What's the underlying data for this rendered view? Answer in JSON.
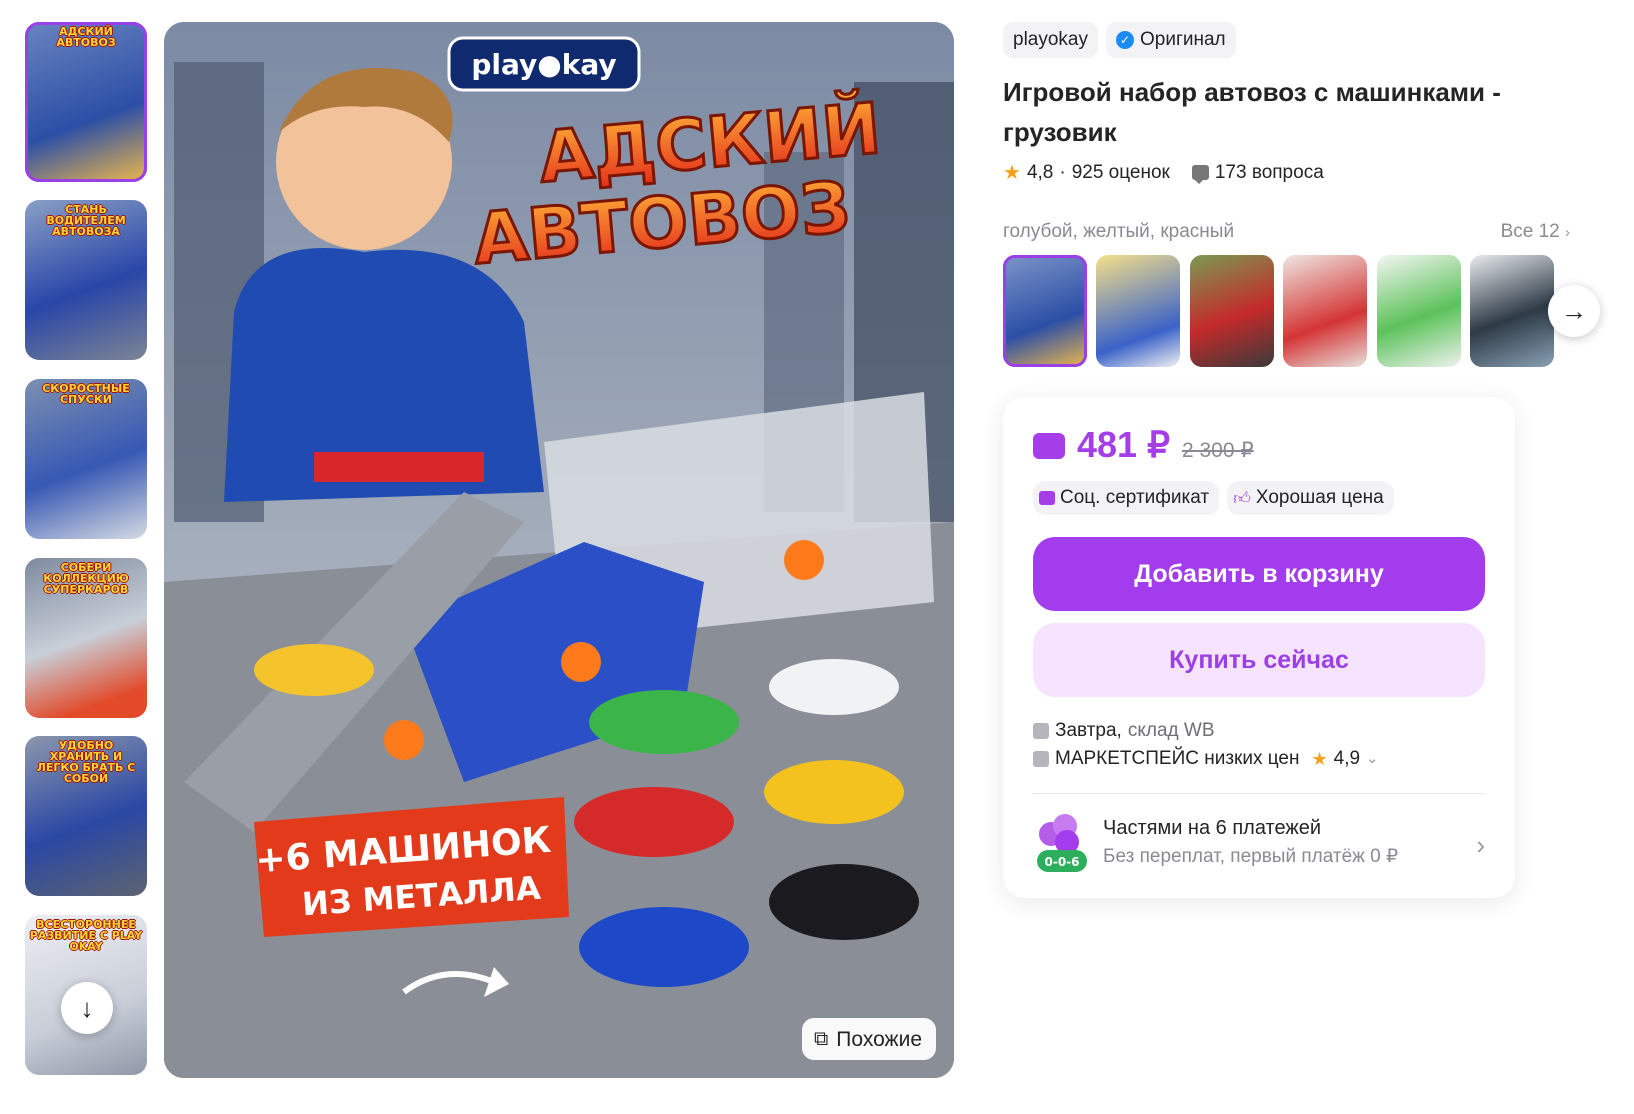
{
  "thumbnails": [
    {
      "caption": "Адский автовоз",
      "selected": true,
      "bg": "#3b5fb8"
    },
    {
      "caption": "Стань водителем автовоза",
      "selected": false,
      "bg": "#4a6fae"
    },
    {
      "caption": "Скоростные спуски",
      "selected": false,
      "bg": "#5a7fb4"
    },
    {
      "caption": "Собери коллекцию суперкаров",
      "selected": false,
      "bg": "#6a86a8"
    },
    {
      "caption": "Удобно хранить и легко брать с собой",
      "selected": false,
      "bg": "#5f7aa0"
    },
    {
      "caption": "Всестороннее развитие с play okay",
      "selected": false,
      "bg": "#d8dce4"
    }
  ],
  "main_image": {
    "brand_logo": "play●kay",
    "headline_1": "АДСКИЙ",
    "headline_2": "АВТОВОЗ",
    "promo_1": "+6 МАШИНОК",
    "promo_2": "ИЗ МЕТАЛЛА",
    "similar_label": "Похожие",
    "similar_icon": "search-similar-icon"
  },
  "product": {
    "brand": "playokay",
    "original_label": "Оригинал",
    "title": "Игровой набор автовоз с машинками - грузовик",
    "rating": "4,8",
    "reviews": "925 оценок",
    "questions": "173 вопроса",
    "color_names": "голубой, желтый, красный",
    "all_variants": "Все 12"
  },
  "variants": [
    {
      "selected": true,
      "bg": "#3a5aa8"
    },
    {
      "selected": false,
      "bg": "#f3d86a"
    },
    {
      "selected": false,
      "bg": "#6a8a4a"
    },
    {
      "selected": false,
      "bg": "#e7e0dc"
    },
    {
      "selected": false,
      "bg": "#eef2ee"
    },
    {
      "selected": false,
      "bg": "#4d5a66"
    }
  ],
  "buy": {
    "price": "481 ₽",
    "old_price": "2 300 ₽",
    "badge_1": "Соц. сертификат",
    "badge_2": "Хорошая цена",
    "add_to_cart": "Добавить в корзину",
    "buy_now": "Купить сейчас",
    "delivery_day": "Завтра,",
    "delivery_from": "склад WB",
    "seller": "МАРКЕТСПЕЙС низких цен",
    "seller_rating": "4,9",
    "installment_title": "Частями на 6 платежей",
    "installment_sub": "Без переплат, первый платёж 0 ₽",
    "installment_badge": "0-0-6"
  },
  "colors": {
    "accent": "#a33ced",
    "accent_light": "#f6e3fd",
    "star": "#f6a11a",
    "verified": "#1b8cf4"
  }
}
